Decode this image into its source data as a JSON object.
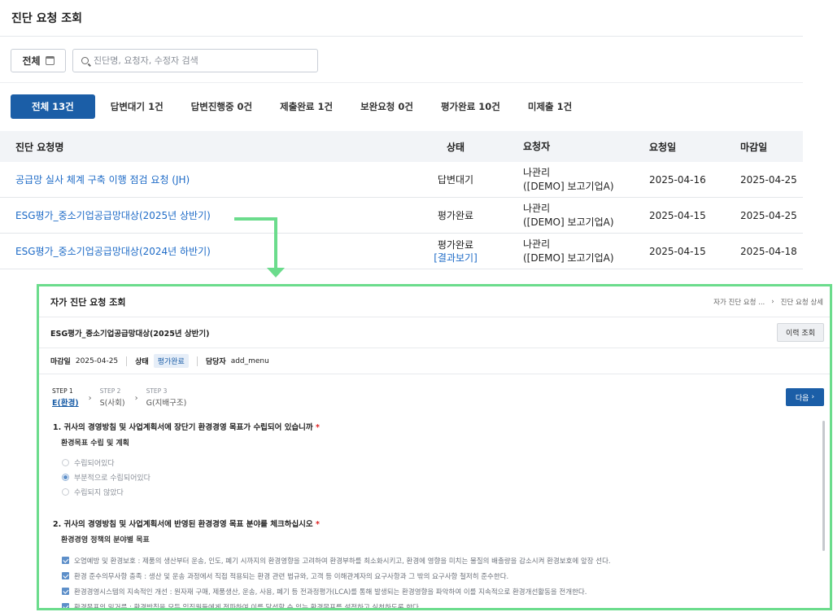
{
  "page": {
    "title": "진단 요청 조회"
  },
  "filter": {
    "period_label": "전체",
    "search_placeholder": "진단명, 요청자, 수정자 검색"
  },
  "tabs": [
    {
      "label": "전체 13건",
      "active": true
    },
    {
      "label": "답변대기 1건"
    },
    {
      "label": "답변진행중 0건"
    },
    {
      "label": "제출완료 1건"
    },
    {
      "label": "보완요청 0건"
    },
    {
      "label": "평가완료 10건"
    },
    {
      "label": "미제출 1건"
    }
  ],
  "table": {
    "headers": {
      "name": "진단 요청명",
      "status": "상태",
      "requester": "요청자",
      "request_date": "요청일",
      "due_date": "마감일"
    },
    "rows": [
      {
        "name": "공급망 실사 체계 구축 이행 점검 요청 (JH)",
        "status": "답변대기",
        "requester1": "나관리",
        "requester2": "([DEMO] 보고기업A)",
        "request_date": "2025-04-16",
        "due_date": "2025-04-25"
      },
      {
        "name": "ESG평가_중소기업공급망대상(2025년 상반기)",
        "status": "평가완료",
        "requester1": "나관리",
        "requester2": "([DEMO] 보고기업A)",
        "request_date": "2025-04-15",
        "due_date": "2025-04-25"
      },
      {
        "name": "ESG평가_중소기업공급망대상(2024년 하반기)",
        "status": "평가완료",
        "status_link": "[결과보기]",
        "requester1": "나관리",
        "requester2": "([DEMO] 보고기업A)",
        "request_date": "2025-04-15",
        "due_date": "2025-04-18"
      }
    ]
  },
  "detail": {
    "title": "자가 진단 요청 조회",
    "breadcrumb": [
      "자가 진단 요청 ...",
      "진단 요청 상세"
    ],
    "subtitle": "ESG평가_중소기업공급망대상(2025년 상반기)",
    "history_button": "이력 조회",
    "meta": {
      "due_label": "마감일",
      "due_value": "2025-04-25",
      "status_label": "상태",
      "status_value": "평가완료",
      "manager_label": "담당자",
      "manager_value": "add_menu"
    },
    "steps": [
      {
        "num": "STEP 1",
        "label": "E(환경)",
        "active": true
      },
      {
        "num": "STEP 2",
        "label": "S(사회)"
      },
      {
        "num": "STEP 3",
        "label": "G(지배구조)"
      }
    ],
    "next_button": "다음",
    "q1": {
      "title": "1.  귀사의 경영방침 및 사업계획서에 장단기 환경경영 목표가 수립되어 있습니까",
      "subtitle": "환경목표 수립 및 계획",
      "options": [
        "수립되어있다",
        "부분적으로 수립되어있다",
        "수립되지 않았다"
      ],
      "selected_index": 1
    },
    "q2": {
      "title": "2.  귀사의 경영방침 및 사업계획서에 반영된 환경경영 목표 분야를 체크하십시오",
      "subtitle": "환경경영 정책의 분야별 목표",
      "options": [
        "오염예방 및 환경보호 : 제품의 생산부터 운송, 인도, 폐기 시까지의 환경영향을 고려하여 환경부하를 최소화시키고, 환경에 영향을 미치는 물질의 배출량을 감소시켜 환경보호에 앞장 선다.",
        "환경 준수의무사항 충족 : 생산 및 운송 과정에서 직접 적용되는 환경 관련 법규와, 고객 등 이해관계자의 요구사항과 그 밖의 요구사항 철저히 준수한다.",
        "환경경영시스템의 지속적인 개선 : 원자재 구매, 제품생산, 운송, 사용, 폐기 등 전과정평가(LCA)를 통해 발생되는 환경영향을 파악하여 이를 지속적으로 환경개선활동을 전개한다.",
        "환경목표의 밑거름 : 환경방침을 모든 임직원들에게 전파하여 이를 달성할 수 있는 환경목표를 설정하고 실천하도록 한다."
      ]
    }
  }
}
